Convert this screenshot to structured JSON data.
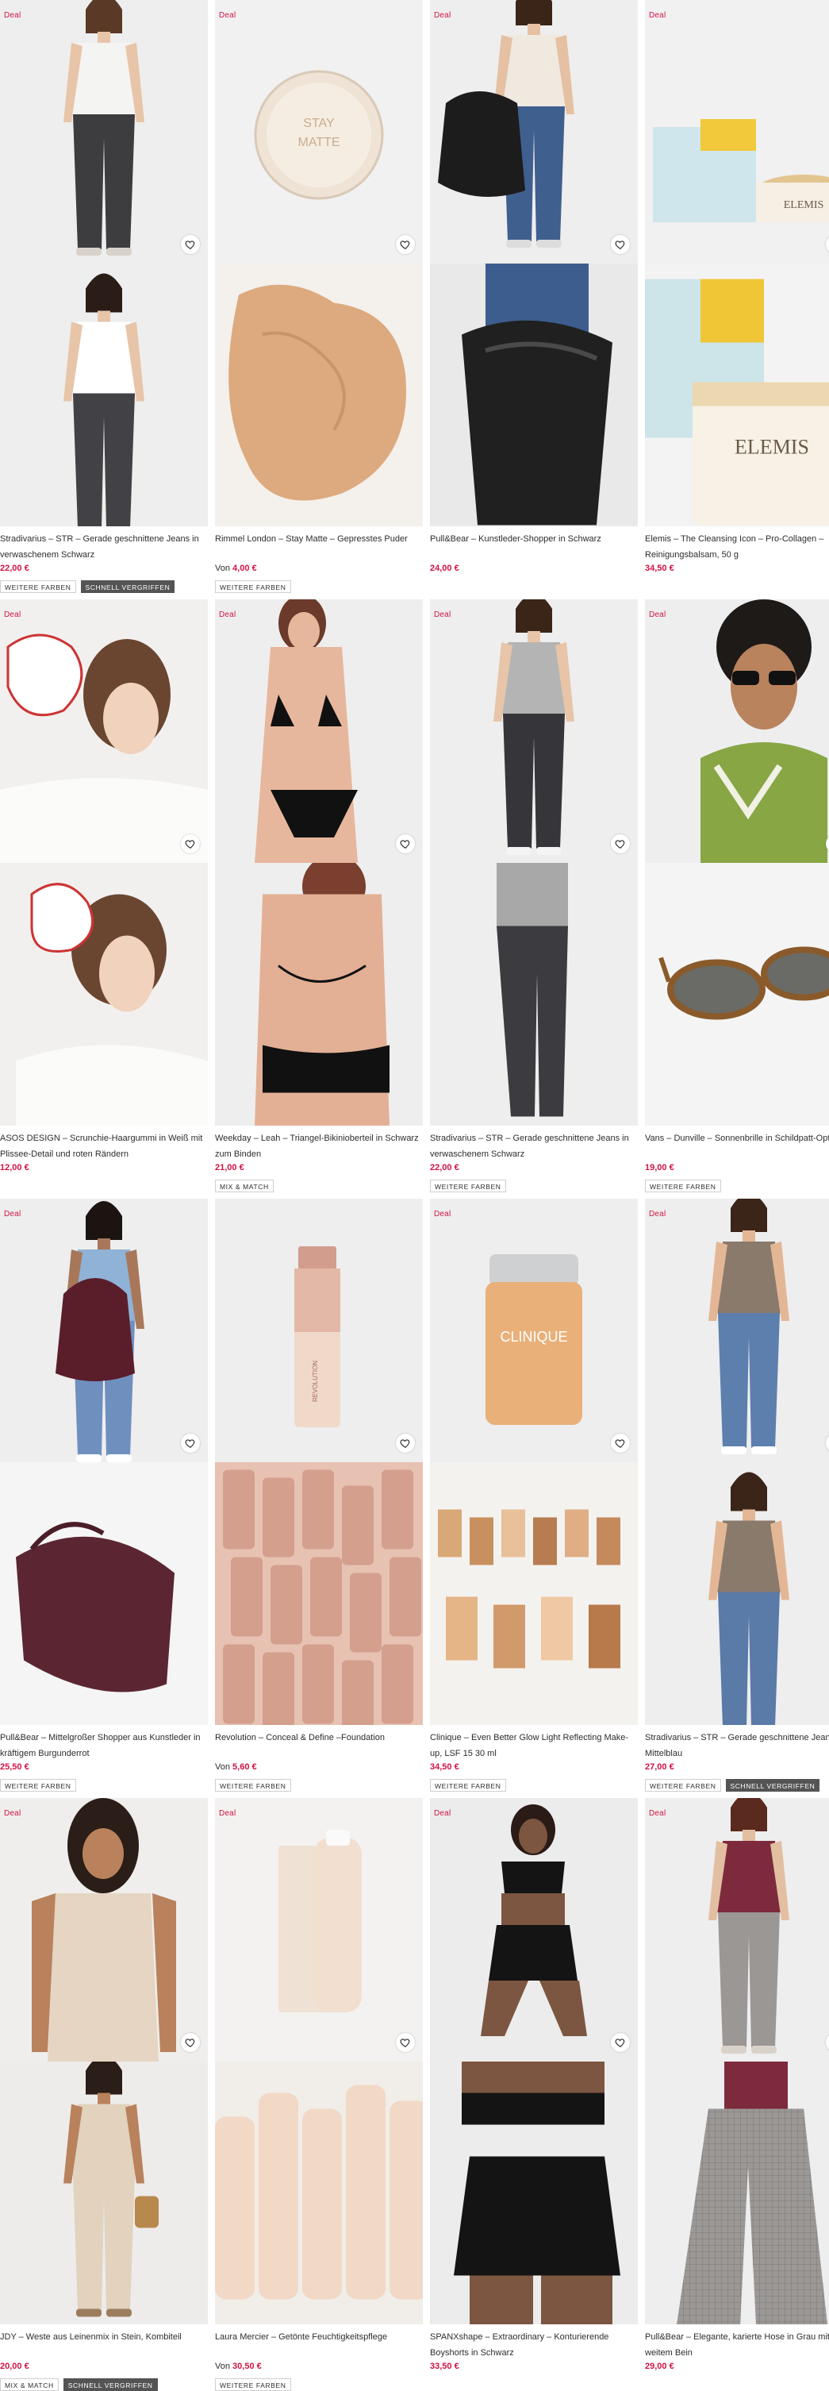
{
  "deal_label": "Deal",
  "products": [
    {
      "title": "Stradivarius – STR – Gerade geschnittene Jeans in verwaschenem Schwarz",
      "price_prefix": "",
      "price": "22,00 €",
      "badges": [
        "WEITERE FARBEN",
        "SCHNELL VERGRIFFEN"
      ],
      "deal": true
    },
    {
      "title": "Rimmel London – Stay Matte – Gepresstes Puder",
      "price_prefix": "Von ",
      "price": "4,00 €",
      "badges": [
        "WEITERE FARBEN"
      ],
      "deal": true
    },
    {
      "title": "Pull&Bear – Kunstleder-Shopper in Schwarz",
      "price_prefix": "",
      "price": "24,00 €",
      "badges": [],
      "deal": true
    },
    {
      "title": "Elemis – The Cleansing Icon – Pro-Collagen – Reinigungsbalsam, 50 g",
      "price_prefix": "",
      "price": "34,50 €",
      "badges": [],
      "deal": true
    },
    {
      "title": "ASOS DESIGN – Scrunchie-Haargummi in Weiß mit Plissee-Detail und roten Rändern",
      "price_prefix": "",
      "price": "12,00 €",
      "badges": [],
      "deal": true
    },
    {
      "title": "Weekday – Leah – Triangel-Bikinioberteil in Schwarz zum Binden",
      "price_prefix": "",
      "price": "21,00 €",
      "badges": [
        "MIX & MATCH"
      ],
      "deal": true
    },
    {
      "title": "Stradivarius – STR – Gerade geschnittene Jeans in verwaschenem Schwarz",
      "price_prefix": "",
      "price": "22,00 €",
      "badges": [
        "WEITERE FARBEN"
      ],
      "deal": true
    },
    {
      "title": "Vans – Dunville – Sonnenbrille in Schildpatt-Optik",
      "price_prefix": "",
      "price": "19,00 €",
      "badges": [
        "WEITERE FARBEN"
      ],
      "deal": true
    },
    {
      "title": "Pull&Bear – Mittelgroßer Shopper aus Kunstleder in kräftigem Burgunderrot",
      "price_prefix": "",
      "price": "25,50 €",
      "badges": [
        "WEITERE FARBEN"
      ],
      "deal": true
    },
    {
      "title": "Revolution – Conceal & Define –Foundation",
      "price_prefix": "Von ",
      "price": "5,60 €",
      "badges": [
        "WEITERE FARBEN"
      ],
      "deal": false
    },
    {
      "title": "Clinique – Even Better Glow Light Reflecting Make-up, LSF 15 30 ml",
      "price_prefix": "",
      "price": "34,50 €",
      "badges": [
        "WEITERE FARBEN"
      ],
      "deal": true
    },
    {
      "title": "Stradivarius – STR – Gerade geschnittene Jeans in Mittelblau",
      "price_prefix": "",
      "price": "27,00 €",
      "badges": [
        "WEITERE FARBEN",
        "SCHNELL VERGRIFFEN"
      ],
      "deal": true
    },
    {
      "title": "JDY – Weste aus Leinenmix in Stein, Kombiteil",
      "price_prefix": "",
      "price": "20,00 €",
      "badges": [
        "MIX & MATCH",
        "SCHNELL VERGRIFFEN"
      ],
      "deal": true
    },
    {
      "title": "Laura Mercier – Getönte Feuchtigkeitspflege",
      "price_prefix": "Von ",
      "price": "30,50 €",
      "badges": [
        "WEITERE FARBEN"
      ],
      "deal": true
    },
    {
      "title": "SPANXshape – Extraordinary – Konturierende Boyshorts in Schwarz",
      "price_prefix": "",
      "price": "33,50 €",
      "badges": [],
      "deal": true
    },
    {
      "title": "Pull&Bear – Elegante, karierte Hose in Grau mit weitem Bein",
      "price_prefix": "",
      "price": "29,00 €",
      "badges": [],
      "deal": true
    }
  ],
  "colors": {
    "accent": "#d01345",
    "text": "#2d2d2d",
    "badge_dark": "#545454"
  },
  "icons": {
    "favourite": "heart-icon"
  }
}
